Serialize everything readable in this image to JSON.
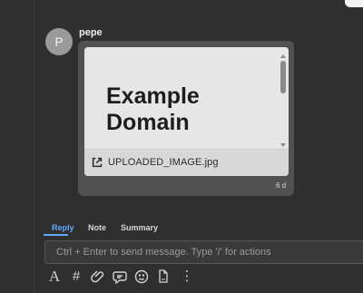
{
  "message": {
    "avatar_initial": "P",
    "author": "pepe",
    "attachment": {
      "preview_title": "Example\nDomain",
      "file_name": "UPLOADED_IMAGE.jpg",
      "icon": "external-link-icon"
    },
    "time": "6 d"
  },
  "tabs": [
    {
      "label": "Reply",
      "active": true
    },
    {
      "label": "Note",
      "active": false
    },
    {
      "label": "Summary",
      "active": false
    }
  ],
  "composer": {
    "placeholder": "Ctrl + Enter to send message. Type '/' for actions"
  },
  "toolbar": {
    "items": [
      {
        "label": "A",
        "icon": "text-format-icon"
      },
      {
        "label": "#",
        "icon": "hashtag-icon"
      },
      {
        "icon": "paperclip-icon"
      },
      {
        "icon": "chat-icon"
      },
      {
        "icon": "emoji-icon"
      },
      {
        "icon": "pdf-icon"
      },
      {
        "label": "⋮",
        "icon": "more-icon"
      }
    ]
  },
  "colors": {
    "background": "#2f2f2f",
    "bubble": "#515151",
    "active_tab": "#63a7ff"
  }
}
